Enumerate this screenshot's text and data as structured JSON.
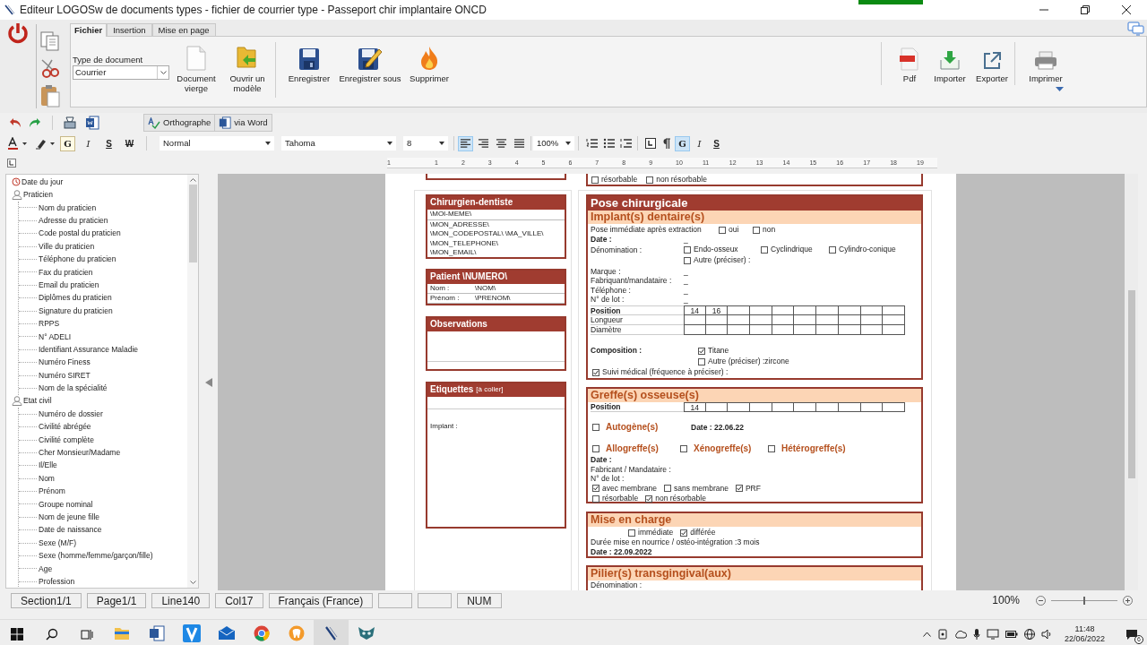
{
  "window": {
    "title": "Editeur LOGOSw de documents types - fichier de courrier type - Passeport chir implantaire ONCD"
  },
  "ribbon": {
    "tabs": [
      {
        "label": "Fichier",
        "selected": true
      },
      {
        "label": "Insertion",
        "selected": false
      },
      {
        "label": "Mise en page",
        "selected": false
      }
    ],
    "document_type": {
      "label": "Type de document",
      "value": "Courrier"
    },
    "left_groups": [
      [
        {
          "kind": "blank",
          "label": "Document vierge"
        },
        {
          "kind": "open",
          "label": "Ouvrir un modèle"
        }
      ],
      [
        {
          "kind": "save",
          "label": "Enregistrer"
        },
        {
          "kind": "save_as",
          "label": "Enregistrer sous"
        },
        {
          "kind": "delete",
          "label": "Supprimer"
        }
      ]
    ],
    "right_groups": [
      [
        {
          "kind": "pdf",
          "label": "Pdf"
        },
        {
          "kind": "import",
          "label": "Importer"
        },
        {
          "kind": "export",
          "label": "Exporter"
        }
      ],
      [
        {
          "kind": "print",
          "label": "Imprimer"
        }
      ]
    ]
  },
  "toolbar": {
    "spell_check": "Orthographe",
    "via_word": "via Word",
    "format_a": [
      {
        "kind": "bold",
        "label": "G",
        "on": true
      },
      {
        "kind": "italic",
        "label": "I",
        "on": false
      },
      {
        "kind": "underline",
        "label": "S",
        "on": false
      },
      {
        "kind": "strike",
        "label": "W",
        "on": false
      }
    ],
    "style": "Normal",
    "font": "Tahoma",
    "size": "8",
    "alignment": [
      {
        "kind": "left",
        "selected": true
      },
      {
        "kind": "right",
        "selected": false
      },
      {
        "kind": "center",
        "selected": false
      },
      {
        "kind": "justify",
        "selected": false
      }
    ],
    "zoom": "100%",
    "format_b": [
      {
        "kind": "bold",
        "label": "G",
        "on": true
      },
      {
        "kind": "italic",
        "label": "I",
        "on": false
      },
      {
        "kind": "underline",
        "label": "S",
        "on": false
      }
    ]
  },
  "ruler": {
    "marks": [
      "1",
      "1",
      "2",
      "3",
      "4",
      "5",
      "6",
      "7",
      "8",
      "9",
      "10",
      "11",
      "12",
      "13",
      "14",
      "15",
      "16",
      "17",
      "18",
      "19"
    ]
  },
  "tree": [
    {
      "kind": "date",
      "label": "Date du jour"
    },
    {
      "kind": "person",
      "label": "Praticien",
      "children": [
        {
          "label": "Nom du praticien"
        },
        {
          "label": "Adresse du praticien"
        },
        {
          "label": "Code postal du praticien"
        },
        {
          "label": "Ville du praticien"
        },
        {
          "label": "Téléphone du praticien"
        },
        {
          "label": "Fax du praticien"
        },
        {
          "label": "Email du praticien"
        },
        {
          "label": "Diplômes du praticien"
        },
        {
          "label": "Signature du praticien"
        },
        {
          "label": "RPPS"
        },
        {
          "label": "N° ADELI"
        },
        {
          "label": "Identifiant Assurance Maladie"
        },
        {
          "label": "Numéro Finess"
        },
        {
          "label": "Numéro SIRET"
        },
        {
          "label": "Nom de la spécialité"
        }
      ]
    },
    {
      "kind": "person",
      "label": "Etat civil",
      "children": [
        {
          "label": "Numéro de dossier"
        },
        {
          "label": "Civilité abrégée"
        },
        {
          "label": "Civilité complète"
        },
        {
          "label": "Cher Monsieur/Madame"
        },
        {
          "label": "Il/Elle"
        },
        {
          "label": "Nom"
        },
        {
          "label": "Prénom"
        },
        {
          "label": "Groupe nominal"
        },
        {
          "label": "Nom de jeune fille"
        },
        {
          "label": "Date de naissance"
        },
        {
          "label": "Sexe (M/F)"
        },
        {
          "label": "Sexe (homme/femme/garçon/fille)"
        },
        {
          "label": "Age"
        },
        {
          "label": "Profession"
        }
      ]
    }
  ],
  "document": {
    "top_strip": {
      "options": [
        {
          "label": "résorbable",
          "checked": false
        },
        {
          "label": "non résorbable",
          "checked": false
        }
      ]
    },
    "left_boxes": [
      {
        "title": "Chirurgien-dentiste",
        "lines": [
          "\\MOI-MEME\\",
          "\\MON_ADRESSE\\",
          "\\MON_CODEPOSTAL\\ \\MA_VILLE\\",
          "\\MON_TELEPHONE\\",
          "\\MON_EMAIL\\"
        ]
      },
      {
        "title": "Patient \\NUMERO\\",
        "rows": [
          [
            "Nom :",
            "\\NOM\\"
          ],
          [
            "Prénom :",
            "\\PRENOM\\"
          ]
        ]
      },
      {
        "title": "Observations"
      },
      {
        "title": "Etiquettes",
        "note": "[à coller]",
        "body": "Implant :"
      }
    ],
    "pose": {
      "title": "Pose chirurgicale",
      "implant": {
        "title": "Implant(s) dentaire(s)",
        "immediate": {
          "label": "Pose immédiate après extraction",
          "options": [
            {
              "label": "oui",
              "checked": false
            },
            {
              "label": "non",
              "checked": false
            }
          ]
        },
        "date": {
          "label": "Date :",
          "value": "_"
        },
        "denomination": {
          "label": "Dénomination :",
          "options": [
            {
              "label": "Endo-osseux",
              "checked": false
            },
            {
              "label": "Cyclindrique",
              "checked": false
            },
            {
              "label": "Cylindro-conique",
              "checked": false
            },
            {
              "label": "Autre (préciser) :",
              "checked": false
            }
          ]
        },
        "fields": [
          {
            "label": "Marque :",
            "value": "_"
          },
          {
            "label": "Fabriquant/mandataire :",
            "value": "_"
          },
          {
            "label": "Téléphone :",
            "value": "_"
          },
          {
            "label": "N° de lot :",
            "value": "_"
          }
        ],
        "table": [
          {
            "label": "Position",
            "cells": [
              "14",
              "16"
            ]
          },
          {
            "label": "Longueur"
          },
          {
            "label": "Diamètre"
          }
        ],
        "composition": {
          "label": "Composition :",
          "options": [
            {
              "label": "Titane",
              "checked": true
            },
            {
              "label": "Autre (préciser) :zircone",
              "checked": false
            }
          ]
        },
        "follow_up": {
          "label": "Suivi médical (fréquence à préciser) :",
          "checked": true
        }
      }
    },
    "greffe": {
      "title": "Greffe(s) osseuse(s)",
      "position": {
        "label": "Position",
        "cells": [
          "14"
        ]
      },
      "autogene": {
        "label": "Autogène(s)",
        "checked": false,
        "date": "Date : 22.06.22"
      },
      "types": [
        {
          "label": "Allogreffe(s)",
          "checked": false
        },
        {
          "label": "Xénogreffe(s)",
          "checked": false
        },
        {
          "label": "Hétérogreffe(s)",
          "checked": false
        }
      ],
      "date_label": "Date :",
      "fields": [
        "Fabricant / Mandataire :",
        "N° de lot :"
      ],
      "membrane": [
        {
          "label": "avec membrane",
          "checked": true
        },
        {
          "label": "sans membrane",
          "checked": false
        },
        {
          "label": "PRF",
          "checked": true
        }
      ],
      "resorption": [
        {
          "label": "résorbable",
          "checked": false
        },
        {
          "label": "non résorbable",
          "checked": true
        }
      ]
    },
    "mise": {
      "title": "Mise en charge",
      "options": [
        {
          "label": "immédiate",
          "checked": false
        },
        {
          "label": "différée",
          "checked": true
        }
      ],
      "duration": "Durée mise en nourrice / ostéo-intégration :3 mois",
      "date": "Date : 22.09.2022"
    },
    "pilier": {
      "title": "Pilier(s) transgingival(aux)",
      "field": "Dénomination :"
    }
  },
  "status_bar": {
    "panes": [
      {
        "kind": "text",
        "text": "Section1/1"
      },
      {
        "kind": "text",
        "text": "Page1/1"
      },
      {
        "kind": "text",
        "text": "Line140"
      },
      {
        "kind": "text",
        "text": "Col17"
      },
      {
        "kind": "text",
        "text": "Français (France)"
      },
      {
        "kind": "blank"
      },
      {
        "kind": "blank"
      },
      {
        "kind": "text",
        "text": "NUM"
      }
    ],
    "zoom": {
      "label": "100%",
      "level": 0.5
    }
  },
  "taskbar": {
    "time": "11:48",
    "date": "22/06/2022",
    "notifications": "6"
  }
}
